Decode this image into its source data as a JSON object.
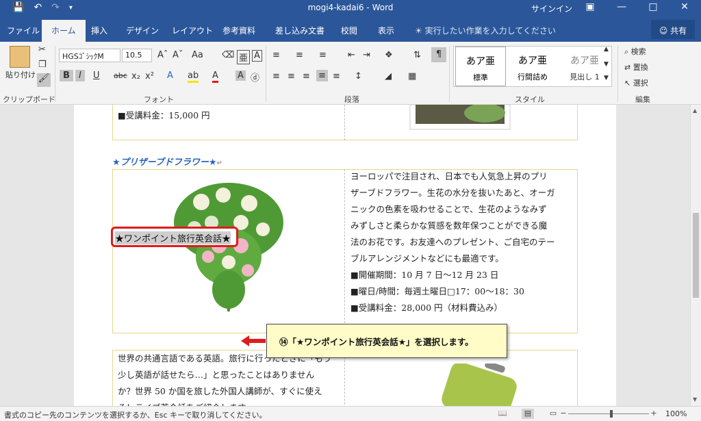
{
  "titlebar": {
    "document_title": "mogi4-kadai6",
    "separator": "-",
    "app": "Word",
    "signin": "サインイン"
  },
  "tabs": [
    {
      "label": "ファイル"
    },
    {
      "label": "ホーム"
    },
    {
      "label": "挿入"
    },
    {
      "label": "デザイン"
    },
    {
      "label": "レイアウト"
    },
    {
      "label": "参考資料"
    },
    {
      "label": "差し込み文書"
    },
    {
      "label": "校閲"
    },
    {
      "label": "表示"
    }
  ],
  "tellme": "実行したい作業を入力してください",
  "share_label": "共有",
  "ribbon": {
    "clipboard": {
      "paste": "貼り付け",
      "label": "クリップボード"
    },
    "font": {
      "name": "HGSｺﾞｼｯｸM",
      "size": "10.5",
      "label": "フォント"
    },
    "paragraph": {
      "label": "段落"
    },
    "styles": {
      "label": "スタイル",
      "items": [
        {
          "preview": "あア亜",
          "name": "標準"
        },
        {
          "preview": "あア亜",
          "name": "行間詰め"
        },
        {
          "preview": "あア亜",
          "name": "見出し 1"
        }
      ]
    },
    "editing": {
      "find": "検索",
      "replace": "置換",
      "select": "選択",
      "label": "編集"
    }
  },
  "document": {
    "prev_fee": "■受講料金：15,000 円",
    "section_heading": "★プリザーブドフラワー★",
    "paragraph_lines": [
      "ヨーロッパで注目され、日本でも人気急上昇のプリ",
      "ザーブドフラワー。生花の水分を抜いたあと、オーガ",
      "ニックの色素を吸わせることで、生花のようなみず",
      "みずしさと柔らかな質感を数年保つことができる魔",
      "法のお花です。お友達へのプレゼント、ご自宅のテー",
      "ブルアレンジメントなどにも最適です。"
    ],
    "period": "■開催期間：10 月 7 日〜12 月 23 日",
    "schedule": "■曜日/時間：毎週土曜日□17：00〜18：30",
    "fee": "■受講料金：28,000 円（材料費込み）",
    "selected_heading": "★ワンポイント旅行英会話★",
    "english_lines": [
      "世界の共通言語である英語。旅行に行ったときに「もう",
      "少し英語が話せたら…」と思ったことはありません",
      "か？世界 50 か国を旅した外国人講師が、すぐに使え",
      "る！ライブ英会話をご紹介します。"
    ]
  },
  "callout": "⑭「★ワンポイント旅行英会話★」を選択します。",
  "statusbar": {
    "message": "書式のコピー先のコンテンツを選択するか、Esc キーで取り消してください。",
    "zoom": "100%"
  },
  "colors": {
    "accent": "#2b579a",
    "selection_border": "#e01b1b",
    "heading": "#2b66b8",
    "callout_bg": "#fffcc8"
  }
}
